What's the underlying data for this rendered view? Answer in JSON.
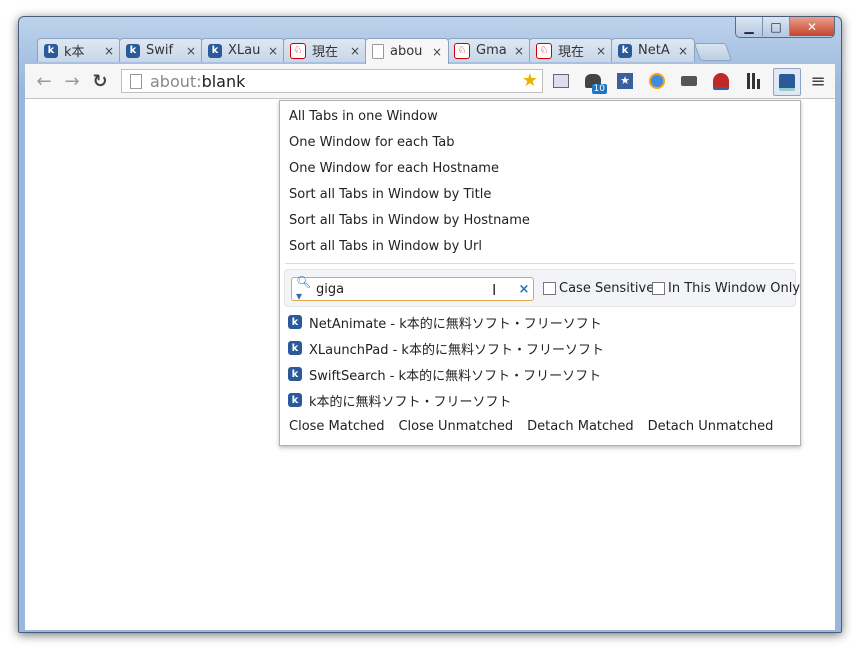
{
  "window": {
    "controls": [
      "▁",
      "□",
      "✕"
    ]
  },
  "tabs": [
    {
      "title": "k本",
      "icon": "k"
    },
    {
      "title": "Swif",
      "icon": "k"
    },
    {
      "title": "XLau",
      "icon": "k"
    },
    {
      "title": "現在",
      "icon": "r"
    },
    {
      "title": "abou",
      "icon": "doc",
      "active": true
    },
    {
      "title": "Gma",
      "icon": "r"
    },
    {
      "title": "現在",
      "icon": "r"
    },
    {
      "title": "NetA",
      "icon": "k"
    }
  ],
  "tab_close": "×",
  "toolbar": {
    "back": "←",
    "forward": "→",
    "reload": "↻",
    "url_scheme": "about:",
    "url_rest": "blank",
    "star": "★",
    "menu": "≡",
    "badge": "10"
  },
  "popup": {
    "commands": [
      "All Tabs in one Window",
      "One Window for each Tab",
      "One Window for each Hostname",
      "Sort all Tabs in Window by Title",
      "Sort all Tabs in Window by Hostname",
      "Sort all Tabs in Window by Url"
    ],
    "search": {
      "value": "giga",
      "clear": "×",
      "case_sensitive": "Case Sensitive",
      "this_window_only": "In This Window Only"
    },
    "results": [
      "NetAnimate - k本的に無料ソフト・フリーソフト",
      "XLaunchPad - k本的に無料ソフト・フリーソフト",
      "SwiftSearch - k本的に無料ソフト・フリーソフト",
      "k本的に無料ソフト・フリーソフト"
    ],
    "actions": [
      "Close Matched",
      "Close Unmatched",
      "Detach Matched",
      "Detach Unmatched"
    ]
  }
}
